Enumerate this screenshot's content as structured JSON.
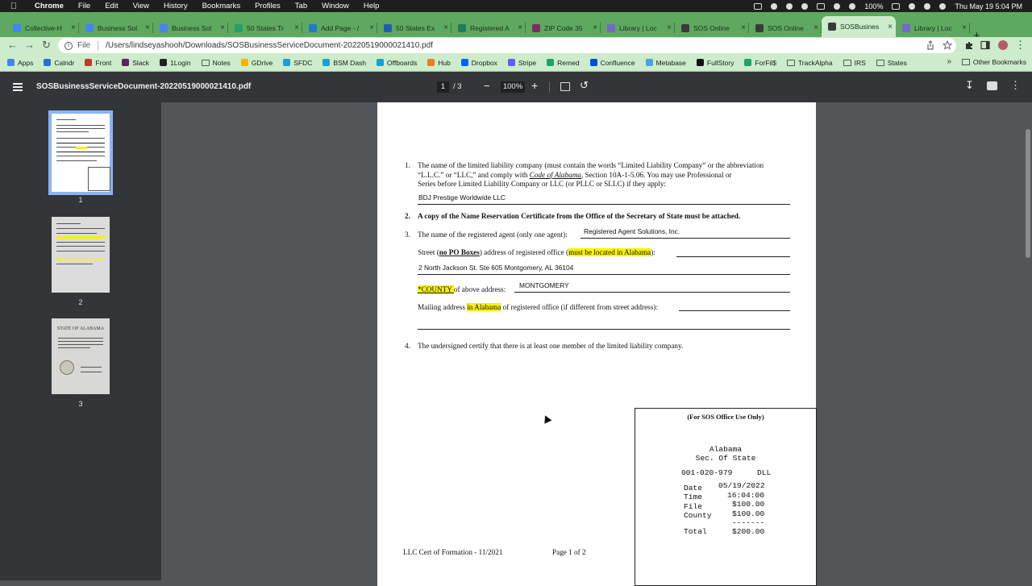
{
  "menubar": {
    "app": "Chrome",
    "items": [
      "File",
      "Edit",
      "View",
      "History",
      "Bookmarks",
      "Profiles",
      "Tab",
      "Window",
      "Help"
    ],
    "battery": "100%",
    "clock": "Thu May 19  5:04 PM"
  },
  "tabs": [
    {
      "label": "Collective-H",
      "color": "#4285f4"
    },
    {
      "label": "Business Sol",
      "color": "#4285f4"
    },
    {
      "label": "Business Sol",
      "color": "#4285f4"
    },
    {
      "label": "50 States Tr",
      "color": "#1ea362"
    },
    {
      "label": "Add Page - /",
      "color": "#1d7cc9"
    },
    {
      "label": "50 States Ex",
      "color": "#1a5fb4"
    },
    {
      "label": "Registered A",
      "color": "#1a7f5a"
    },
    {
      "label": "ZIP Code 35",
      "color": "#7b2d5f"
    },
    {
      "label": "Library | Loc",
      "color": "#7468c9"
    },
    {
      "label": "SOS Online",
      "color": "#3a3a3a"
    },
    {
      "label": "SOS Online",
      "color": "#3a3a3a"
    },
    {
      "label": "SOSBusines",
      "color": "#3a3a3a",
      "active": true
    },
    {
      "label": "Library | Loc",
      "color": "#7468c9"
    }
  ],
  "toolbar": {
    "file_label": "File",
    "url": "/Users/lindseyashooh/Downloads/SOSBusinessServiceDocument-20220519000021410.pdf"
  },
  "bookmarks": [
    {
      "label": "Apps",
      "color": "#4285f4"
    },
    {
      "label": "Calndr",
      "color": "#2a6fd6"
    },
    {
      "label": "Front",
      "color": "#c0392b"
    },
    {
      "label": "Slack",
      "color": "#611f69"
    },
    {
      "label": "1Login",
      "color": "#222"
    },
    {
      "label": "Notes",
      "folder": true
    },
    {
      "label": "GDrive",
      "color": "#f4b400"
    },
    {
      "label": "SFDC",
      "color": "#1a9fd6"
    },
    {
      "label": "BSM Dash",
      "color": "#1a9fd6"
    },
    {
      "label": "Offboards",
      "color": "#1a9fd6"
    },
    {
      "label": "Hub",
      "color": "#e67e22"
    },
    {
      "label": "Dropbox",
      "color": "#0061ff"
    },
    {
      "label": "Stripe",
      "color": "#635bff"
    },
    {
      "label": "Remed",
      "color": "#1ea362"
    },
    {
      "label": "Confluence",
      "color": "#0052cc"
    },
    {
      "label": "Metabase",
      "color": "#509ee3"
    },
    {
      "label": "FullStory",
      "color": "#111"
    },
    {
      "label": "ForFil$",
      "color": "#1ea362"
    },
    {
      "label": "TrackAlpha",
      "folder": true
    },
    {
      "label": "IRS",
      "folder": true
    },
    {
      "label": "States",
      "folder": true
    }
  ],
  "bookmarks_more": "»",
  "bookmarks_other": "Other Bookmarks",
  "pdf": {
    "title": "SOSBusinessServiceDocument-20220519000021410.pdf",
    "current_page": "1",
    "total_pages": "/ 3",
    "zoom": "100%",
    "thumb_labels": [
      "1",
      "2",
      "3"
    ],
    "thumb3_heading": "STATE OF ALABAMA"
  },
  "doc": {
    "item1_num": "1.",
    "item1_line1": "The name of the limited liability company (must contain the words  “Limited Liability Company” or  the abbreviation",
    "item1_line2_a": "“L.L.C.” or “LLC,”  and comply with ",
    "item1_line2_b": "Code of Alabama",
    "item1_line2_c": ", Section 10A-1-5.06. You may use Professional or",
    "item1_line3": "Series before Limited Liability Company or LLC (or PLLC or SLLC) if they apply:",
    "llc_name": "BDJ Prestige Worldwide LLC",
    "item2_num": "2.",
    "item2_text": "A copy of the Name Reservation Certificate from the Office of the Secretary of State must be attached.",
    "item3_num": "3.",
    "item3_text": "The name of the registered agent (only one agent):",
    "agent_name": "Registered Agent Solutions, Inc.",
    "street_a": "Street (",
    "street_b": "no PO Boxes",
    "street_c": ") address of registered office (",
    "street_d": "must be located in Alabama",
    "street_e": "):",
    "street_value": "2 North Jackson St. Ste 605 Montgomery, AL 36104",
    "county_a": "*COUNTY ",
    "county_b": "of above address:",
    "county_value": "MONTGOMERY",
    "mailing_a": "Mailing address ",
    "mailing_b": "in Alabama",
    "mailing_c": " of registered office (if different from street address):",
    "item4_num": "4.",
    "item4_text": "The undersigned certify that there is at least one member of the limited liability company.",
    "footer_left": "LLC Cert of Formation - 11/2021",
    "footer_center": "Page 1 of 2"
  },
  "sos_box": {
    "heading": "(For SOS Office Use Only)",
    "line1": "Alabama",
    "line2": "Sec. Of State",
    "filing_no": "001-020-979",
    "code": "DLL",
    "date_label": "Date",
    "date_value": "05/19/2022",
    "time_label": "Time",
    "time_value": "16:04:00",
    "file_label": "File",
    "file_value": "$100.00",
    "county_label": "County",
    "county_value": "$100.00",
    "dashes": "-------",
    "total_label": "Total",
    "total_value": "$200.00"
  }
}
